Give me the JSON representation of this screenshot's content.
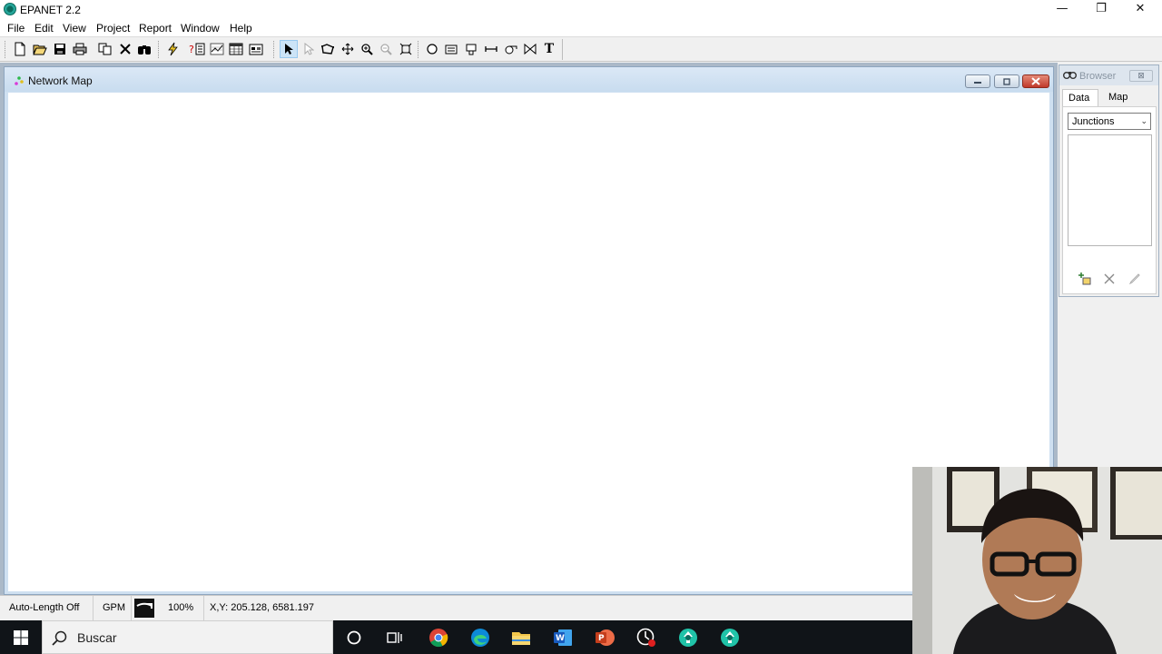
{
  "window": {
    "title": "EPANET 2.2",
    "minimize_glyph": "—",
    "restore_glyph": "❐",
    "close_glyph": "✕"
  },
  "menu": [
    "File",
    "Edit",
    "View",
    "Project",
    "Report",
    "Window",
    "Help"
  ],
  "toolbar": {
    "icons": [
      "new-icon",
      "open-icon",
      "save-icon",
      "print-icon",
      "copy-icon",
      "delete-icon",
      "find-icon",
      "run-icon",
      "query-icon",
      "graph-icon",
      "table-icon",
      "options-icon",
      "select-object-icon",
      "select-vertex-icon",
      "select-region-icon",
      "pan-icon",
      "zoom-in-icon",
      "zoom-out-icon",
      "full-extent-icon",
      "junction-icon",
      "reservoir-icon",
      "tank-icon",
      "pipe-icon",
      "pump-icon",
      "valve-icon",
      "label-icon"
    ],
    "label_glyph": "T"
  },
  "network_map": {
    "title": "Network Map"
  },
  "browser": {
    "title": "Browser",
    "close_glyph": "⊠",
    "tabs": [
      "Data",
      "Map"
    ],
    "active_tab": "Data",
    "category": "Junctions",
    "chevron": "⌄"
  },
  "status_bar": {
    "auto_length": "Auto-Length Off",
    "flow_units": "GPM",
    "zoom": "100%",
    "xy": "X,Y: 205.128, 6581.197"
  },
  "taskbar": {
    "search_placeholder": "Buscar",
    "apps": [
      "cortana-icon",
      "task-view-icon",
      "chrome-icon",
      "edge-icon",
      "file-explorer-icon",
      "word-icon",
      "powerpoint-icon",
      "recorder-icon",
      "epanet-icon",
      "epanet-icon"
    ]
  },
  "colors": {
    "accent": "#0078d7",
    "taskbar": "#101418",
    "close_red": "#c0392b"
  }
}
